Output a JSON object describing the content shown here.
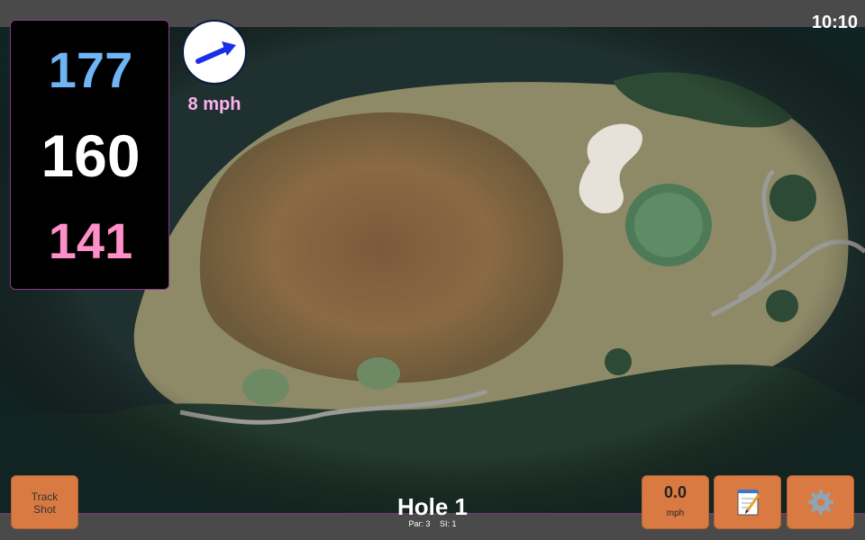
{
  "status": {
    "time": "10:10"
  },
  "distances": {
    "back": "177",
    "middle": "160",
    "front": "141"
  },
  "wind": {
    "speed": "8 mph",
    "icon": "wind-direction-arrow-icon"
  },
  "hole": {
    "title": "Hole 1",
    "par": "Par: 3",
    "si": "SI: 1"
  },
  "buttons": {
    "track_shot": "Track Shot",
    "speed_value": "0.0",
    "speed_unit": "mph",
    "notes_icon": "notepad-icon",
    "settings_icon": "gear-icon"
  },
  "colors": {
    "back_distance": "#6fb4f4",
    "middle_distance": "#ffffff",
    "front_distance": "#ff8fc8",
    "button": "#d97a43",
    "wind_text": "#ffb3ee"
  }
}
